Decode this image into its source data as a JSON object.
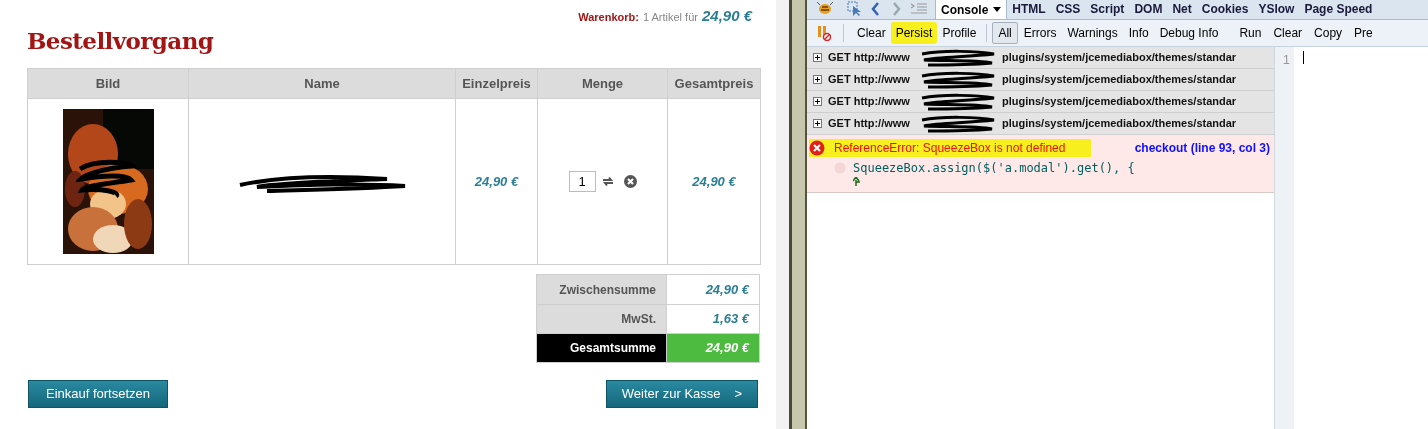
{
  "cart_summary": {
    "label": "Warenkorb:",
    "text": "1 Artikel für",
    "total": "24,90 €"
  },
  "heading": "Bestellvorgang",
  "table": {
    "columns": [
      "Bild",
      "Name",
      "Einzelpreis",
      "Menge",
      "Gesamtpreis"
    ],
    "rows": [
      {
        "unit_price": "24,90 €",
        "quantity": "1",
        "total": "24,90 €"
      }
    ]
  },
  "totals": [
    {
      "label": "Zwischensumme",
      "value": "24,90 €",
      "kind": "normal"
    },
    {
      "label": "MwSt.",
      "value": "1,63 €",
      "kind": "normal"
    },
    {
      "label": "Gesamtsumme",
      "value": "24,90 €",
      "kind": "grand"
    }
  ],
  "buttons": [
    {
      "label": "Einkauf fortsetzen"
    },
    {
      "label": "Weiter zur Kasse",
      "icon": ">"
    }
  ],
  "devtools": {
    "tabs": [
      {
        "label": "Console",
        "selected": true
      },
      {
        "label": "HTML",
        "selected": false
      },
      {
        "label": "CSS",
        "selected": false
      },
      {
        "label": "Script",
        "selected": false
      },
      {
        "label": "DOM",
        "selected": false
      },
      {
        "label": "Net",
        "selected": false
      },
      {
        "label": "Cookies",
        "selected": false
      },
      {
        "label": "YSlow",
        "selected": false
      },
      {
        "label": "Page Speed",
        "selected": false
      }
    ],
    "toolbar": [
      {
        "label": "Clear",
        "highlighted": false
      },
      {
        "label": "Persist",
        "highlighted": true
      },
      {
        "label": "Profile",
        "highlighted": false
      }
    ],
    "filters": [
      {
        "label": "All",
        "selected": true
      },
      {
        "label": "Errors",
        "selected": false
      },
      {
        "label": "Warnings",
        "selected": false
      },
      {
        "label": "Info",
        "selected": false
      },
      {
        "label": "Debug Info",
        "selected": false
      }
    ],
    "editor_actions": [
      "Run",
      "Clear",
      "Copy",
      "Pre"
    ],
    "requests": [
      {
        "prefix": "GET http://www",
        "suffix": "plugins/system/jcemediabox/themes/standar"
      },
      {
        "prefix": "GET http://www",
        "suffix": "plugins/system/jcemediabox/themes/standar"
      },
      {
        "prefix": "GET http://www",
        "suffix": "plugins/system/jcemediabox/themes/standar"
      },
      {
        "prefix": "GET http://www",
        "suffix": "plugins/system/jcemediabox/themes/standar"
      }
    ],
    "error": {
      "message": "ReferenceError: SqueezeBox is not defined",
      "highlighted": true,
      "source": "checkout (line 93, col 3)",
      "code": "SqueezeBox.assign($('a.modal').get(), {"
    },
    "editor": {
      "line_number": "1"
    }
  }
}
